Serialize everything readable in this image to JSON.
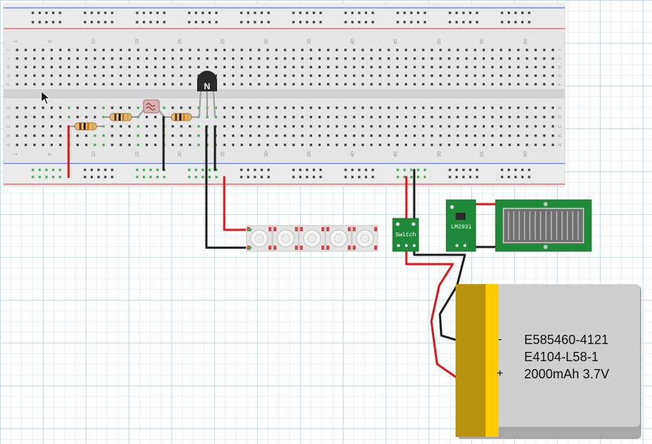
{
  "breadboard": {
    "column_numbers": [
      "1",
      "5",
      "10",
      "15",
      "20",
      "25",
      "30",
      "35",
      "40",
      "45",
      "50",
      "55",
      "60"
    ],
    "row_letters_top": [
      "J",
      "I",
      "H",
      "G",
      "F"
    ],
    "row_letters_bottom": [
      "E",
      "D",
      "C",
      "B",
      "A"
    ]
  },
  "transistor": {
    "label": "N"
  },
  "switch_module": {
    "label": "Switch"
  },
  "regulator": {
    "label": "LM2931"
  },
  "battery": {
    "line1": "E585460-4121",
    "line2": "E4104-L58-1",
    "line3": "2000mAh 3.7V",
    "minus": "-",
    "plus": "+"
  },
  "colors": {
    "wire_red": "#e0161b",
    "wire_black": "#1a1a1a",
    "pcb_green": "#1f8a3a",
    "battery_body": "#cfcfcf",
    "battery_gold": "#b8920f",
    "battery_yellow": "#ffcc00",
    "rail_red": "#d23b3b",
    "rail_blue": "#3b5fd2"
  },
  "icons": {
    "cursor": "mouse-pointer-icon"
  }
}
